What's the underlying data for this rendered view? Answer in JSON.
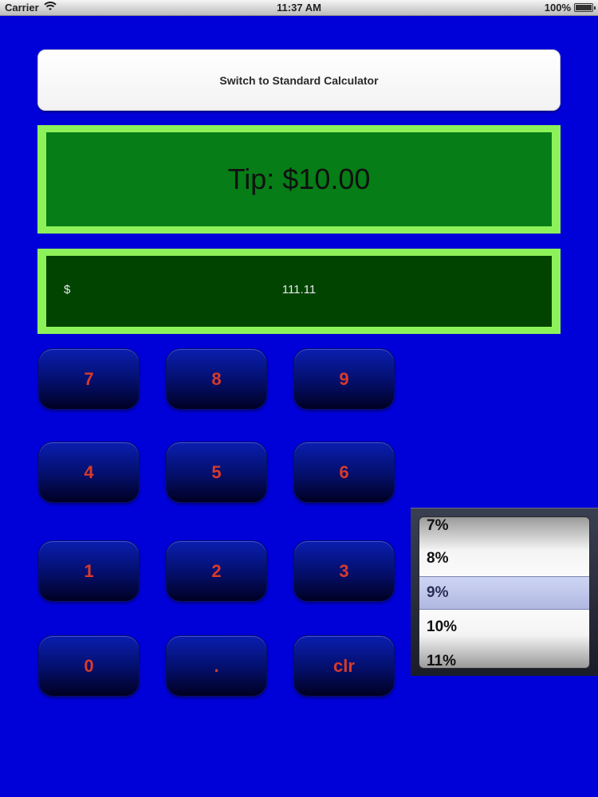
{
  "status_bar": {
    "carrier": "Carrier",
    "time": "11:37 AM",
    "battery": "100%",
    "battery_level": 1.0
  },
  "switch_button": {
    "label": "Switch to Standard Calculator"
  },
  "tip_display": {
    "text": "Tip: $10.00"
  },
  "amount_display": {
    "currency": "$",
    "value": "111.11"
  },
  "keypad": {
    "keys": [
      "7",
      "8",
      "9",
      "4",
      "5",
      "6",
      "1",
      "2",
      "3",
      "0",
      ".",
      "clr"
    ]
  },
  "tip_picker": {
    "options": [
      "7%",
      "8%",
      "9%",
      "10%",
      "11%"
    ],
    "selected": "9%"
  },
  "colors": {
    "background": "#0000d8",
    "accent_border": "#8df25a",
    "tip_background": "#067d17",
    "amount_background": "#004400",
    "key_text": "#d83a2a"
  }
}
